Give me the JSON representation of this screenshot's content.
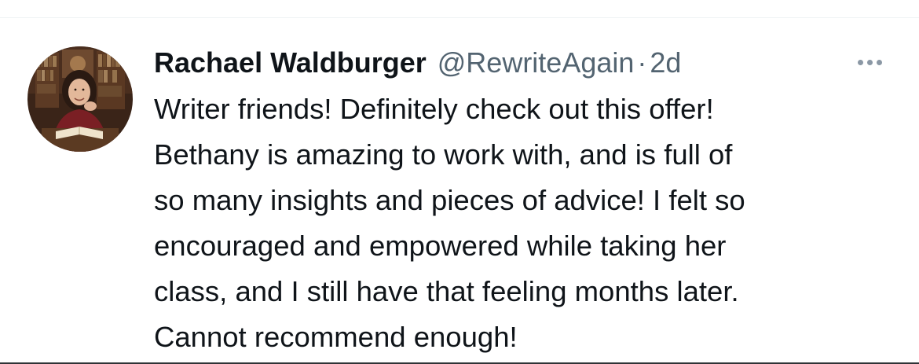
{
  "tweet": {
    "author": {
      "display_name": "Rachael Waldburger",
      "handle": "@RewriteAgain",
      "avatar": "avatar-photo"
    },
    "separator": "·",
    "timestamp": "2d",
    "more_icon": "more-horizontal-icon",
    "text_lines": [
      "Writer friends! Definitely check out this offer!",
      "Bethany is amazing to work with, and is full of",
      "so many insights and pieces of advice! I felt so",
      "encouraged and empowered while taking her",
      "class, and I still have that feeling months later.",
      "Cannot recommend enough!"
    ]
  },
  "colors": {
    "text_primary": "#0f1419",
    "text_secondary": "#536471",
    "icon": "#8b98a5",
    "background": "#ffffff"
  }
}
